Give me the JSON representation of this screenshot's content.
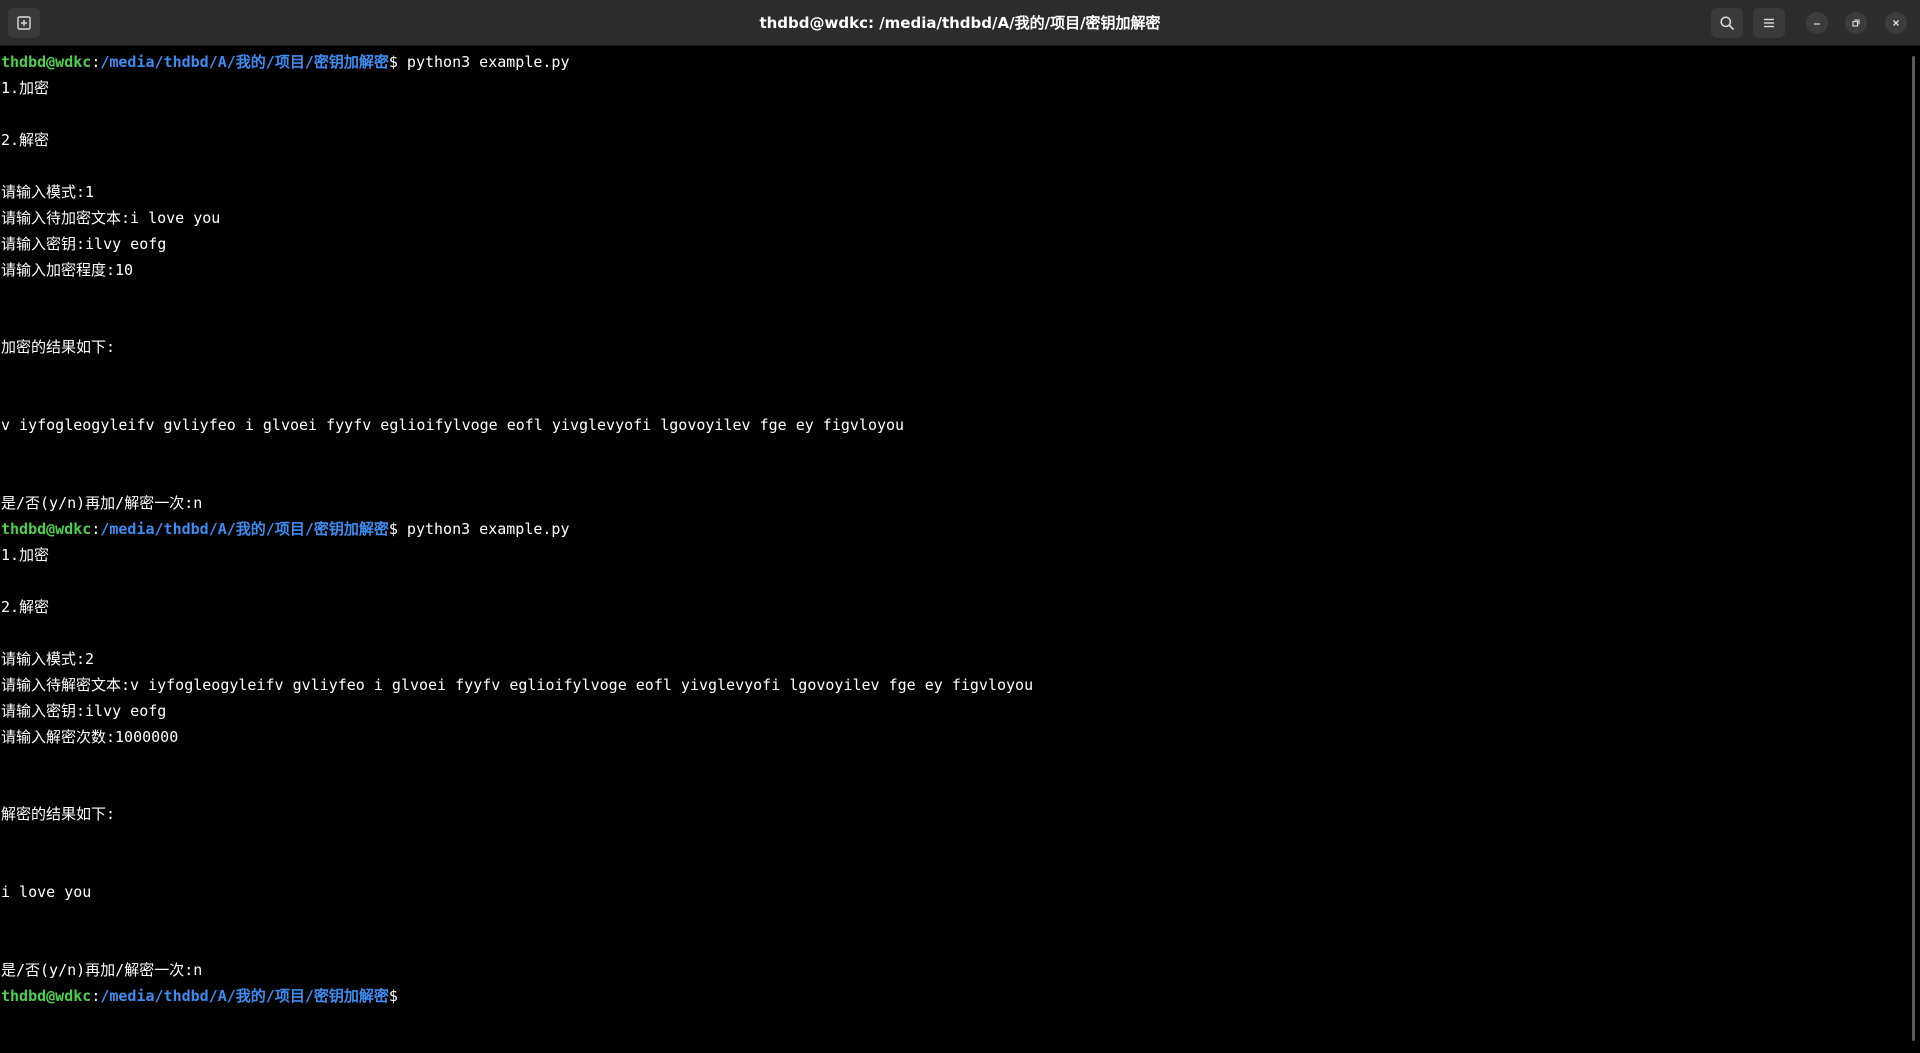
{
  "window": {
    "title": "thdbd@wdkc: /media/thdbd/A/我的/项目/密钥加解密"
  },
  "icons": {
    "new_tab": "new-tab-icon",
    "search": "search-icon",
    "menu": "hamburger-menu-icon",
    "minimize": "minimize-icon",
    "maximize": "restore-icon",
    "close": "close-icon"
  },
  "colors": {
    "prompt_user": "#4ed04e",
    "prompt_path": "#3d8cf0",
    "background": "#000000",
    "foreground": "#ffffff",
    "titlebar": "#2c2c2c"
  },
  "terminal": {
    "prompt1": {
      "user": "thdbd@wdkc",
      "sep": ":",
      "path": "/media/thdbd/A/我的/项目/密钥加解密",
      "dollar": "$",
      "command": " python3 example.py"
    },
    "run1": {
      "menu1": "1.加密",
      "menu2": "2.解密",
      "mode": "请输入模式:1",
      "text": "请输入待加密文本:i love you",
      "key": "请输入密钥:ilvy eofg",
      "level": "请输入加密程度:10",
      "result_header": "加密的结果如下:",
      "result": "v iyfogleogyleifv gvliyfeo i glvoei fyyfv eglioifylvoge eofl yivglevyofi lgovoyilev fge ey figvloyou",
      "again": "是/否(y/n)再加/解密一次:n"
    },
    "prompt2": {
      "user": "thdbd@wdkc",
      "sep": ":",
      "path": "/media/thdbd/A/我的/项目/密钥加解密",
      "dollar": "$",
      "command": " python3 example.py"
    },
    "run2": {
      "menu1": "1.加密",
      "menu2": "2.解密",
      "mode": "请输入模式:2",
      "text": "请输入待解密文本:v iyfogleogyleifv gvliyfeo i glvoei fyyfv eglioifylvoge eofl yivglevyofi lgovoyilev fge ey figvloyou",
      "key": "请输入密钥:ilvy eofg",
      "count": "请输入解密次数:1000000",
      "result_header": "解密的结果如下:",
      "result": "i love you",
      "again": "是/否(y/n)再加/解密一次:n"
    },
    "prompt3": {
      "user": "thdbd@wdkc",
      "sep": ":",
      "path": "/media/thdbd/A/我的/项目/密钥加解密",
      "dollar": "$"
    }
  }
}
